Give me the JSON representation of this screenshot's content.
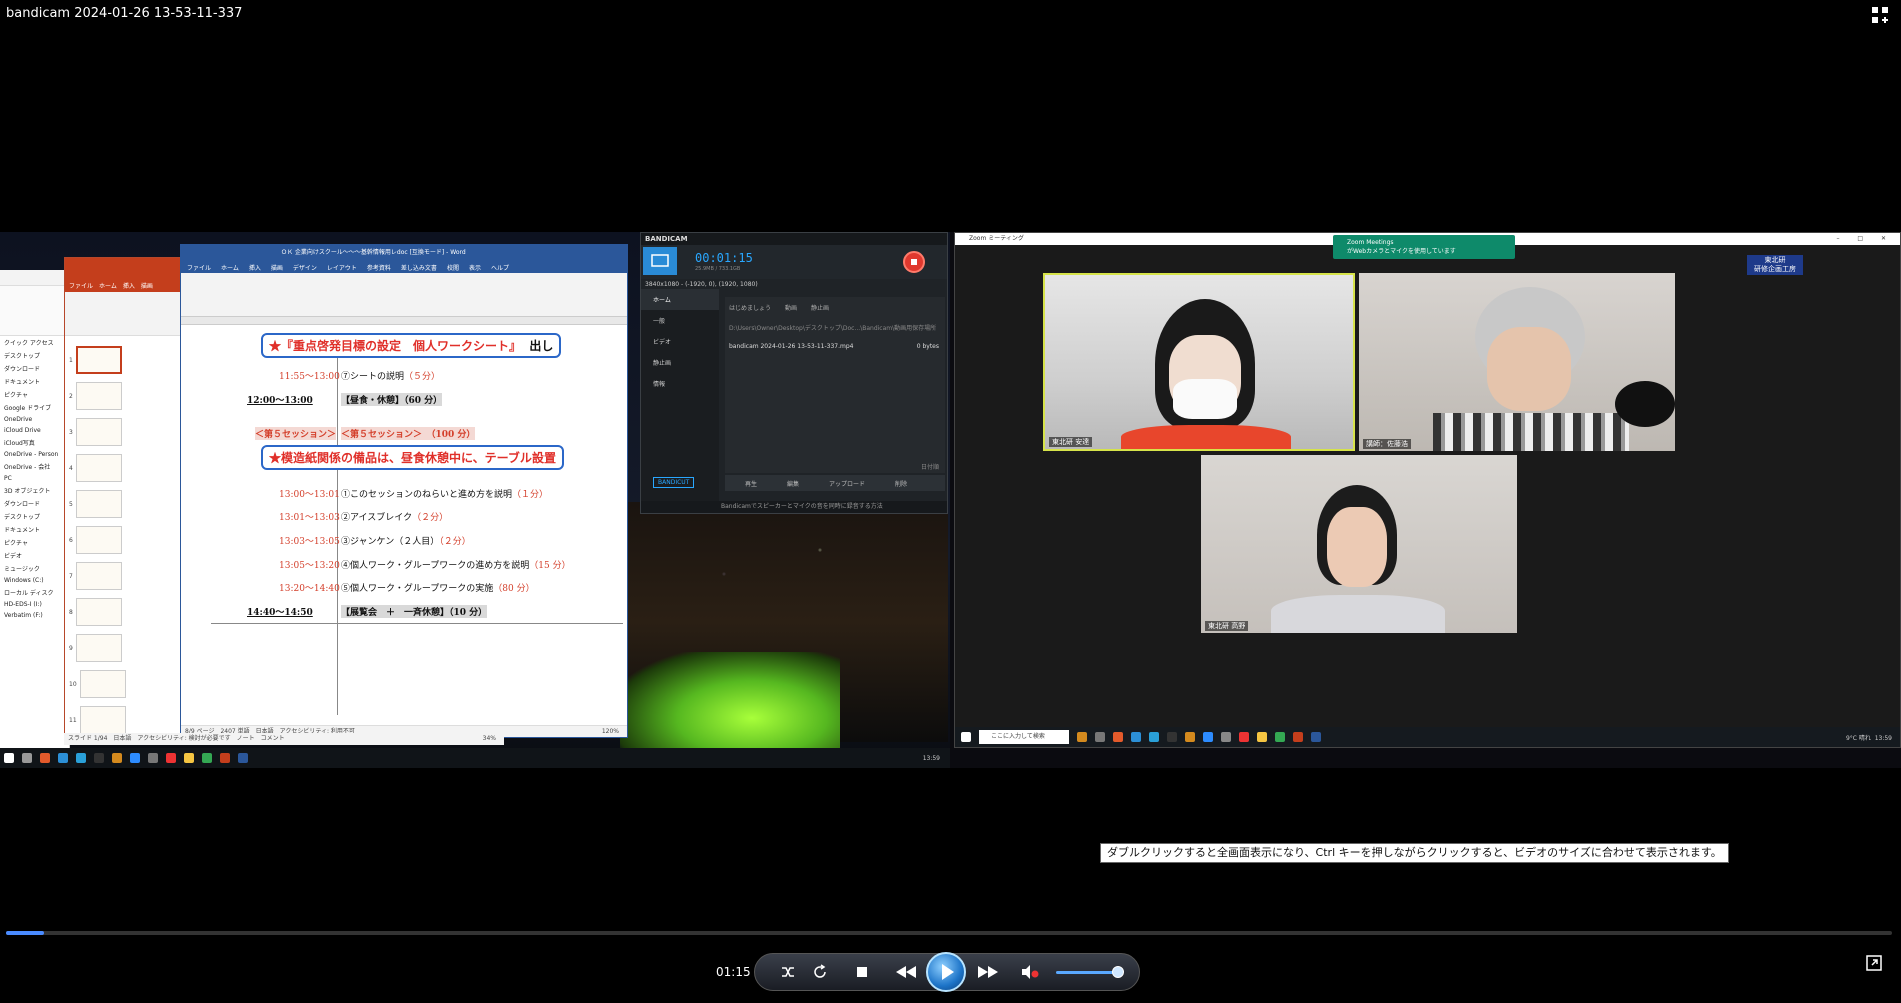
{
  "window": {
    "title": "bandicam 2024-01-26 13-53-11-337"
  },
  "tooltip": "ダブルクリックすると全画面表示になり、Ctrl キーを押しながらクリックすると、ビデオのサイズに合わせて表示されます。",
  "player": {
    "time": "01:15",
    "progress": 0.02
  },
  "word": {
    "title": "ＯＫ 企業向けスクール～～～基幹情報用レdoc [互換モード] - Word",
    "tabs": [
      "ファイル",
      "ホーム",
      "挿入",
      "描画",
      "デザイン",
      "レイアウト",
      "参考資料",
      "差し込み文書",
      "校閲",
      "表示",
      "ヘルプ"
    ],
    "status": "8/9 ページ　2407 単語　日本語　アクセシビリティ: 利用不可",
    "zoom": "120%",
    "heading1": {
      "star": "★",
      "text": "『重点啓発目標の設定　個人ワークシート』",
      "tail": "出し"
    },
    "heading2": {
      "star": "★",
      "text": "模造紙関係の備品は、昼食休憩中に、テーブル設置"
    },
    "rows": [
      {
        "time": "11:55～13:00",
        "item": "⑦シートの説明",
        "dur": "（５分）"
      },
      {
        "time": "12:00～13:00",
        "item": "【昼食・休憩】（60 分）"
      },
      {
        "time": "＜第５セッション＞",
        "item": "＜第５セッション＞　（100 分）"
      },
      {
        "time": "13:00～13:01",
        "item": "①このセッションのねらいと進め方を説明",
        "dur": "（１分）"
      },
      {
        "time": "13:01～13:03",
        "item": "②アイスブレイク",
        "dur": "（２分）"
      },
      {
        "time": "13:03～13:05",
        "item": "③ジャンケン（２人目）",
        "dur": "（２分）"
      },
      {
        "time": "13:05～13:20",
        "item": "④個人ワーク・グループワークの進め方を説明",
        "dur": "（15 分）"
      },
      {
        "time": "13:20～14:40",
        "item": "⑤個人ワーク・グループワークの実施",
        "dur": "（80 分）"
      },
      {
        "time": "14:40～14:50",
        "item": "【展覧会　＋　一斉休憩】（10 分）"
      }
    ]
  },
  "ppt": {
    "tabs": [
      "ファイル",
      "ホーム",
      "挿入",
      "描画"
    ],
    "status": "スライド 1/94　日本語　アクセシビリティ: 検討が必要です　ノート　コメント",
    "zoom": "34%",
    "thumbs": [
      "1",
      "2",
      "3",
      "4",
      "5",
      "6",
      "7",
      "8",
      "9",
      "10",
      "11"
    ]
  },
  "explorer": {
    "items": [
      "クイック アクセス",
      "デスクトップ",
      "ダウンロード",
      "ドキュメント",
      "ピクチャ",
      "Google ドライブ",
      "OneDrive",
      "iCloud Drive",
      "iCloud写真",
      "OneDrive - Person",
      "OneDrive - 会社",
      "PC",
      "3D オブジェクト",
      "ダウンロード",
      "デスクトップ",
      "ドキュメント",
      "ピクチャ",
      "ビデオ",
      "ミュージック",
      "Windows (C:)",
      "ローカル ディスク",
      "HD-EDS-I (I:)",
      "Verbatim (F:)"
    ]
  },
  "bandicam": {
    "brand": "BANDICAM",
    "timer": "00:01:15",
    "size": "25.9MB / 733.1GB",
    "resolution": "3840x1080 - (-1920, 0), (1920, 1080)",
    "sidebar": [
      "ホーム",
      "一般",
      "ビデオ",
      "静止画",
      "情報"
    ],
    "list_tabs": [
      "はじめましょう",
      "動画",
      "静止画"
    ],
    "path": "D:\\Users\\Owner\\Desktop\\デスクトップ\\Doc...\\Bandicam\\動画用保存場所",
    "file": "bandicam 2024-01-26 13-53-11-337.mp4",
    "file_size": "0 bytes",
    "buttons": [
      "再生",
      "編集",
      "アップロード",
      "削除"
    ],
    "sort": "日付順",
    "logo": "BANDICUT",
    "footer": "Bandicamでスピーカーとマイクの音を同時に録音する方法"
  },
  "zoom": {
    "title": "Zoom ミーティング",
    "notice_title": "Zoom Meetings",
    "notice_text": "がWebカメラとマイクを使用しています",
    "name_tag": [
      "東北研",
      "研修企画工房"
    ],
    "tiles": [
      {
        "label": "東北研 安達"
      },
      {
        "label": "講師：佐藤浩"
      },
      {
        "label": "東北研 高野"
      }
    ],
    "search": "ここに入力して検索",
    "tray": "9°C 晴れ",
    "clock": "13:59"
  },
  "left_taskbar": {
    "clock": "13:59"
  },
  "colors": {
    "accent": "#4a8bff",
    "word": "#2b579a",
    "ppt": "#c43e1c",
    "heading_red": "#e0302a",
    "zoom_notice": "#0e8a6a"
  }
}
